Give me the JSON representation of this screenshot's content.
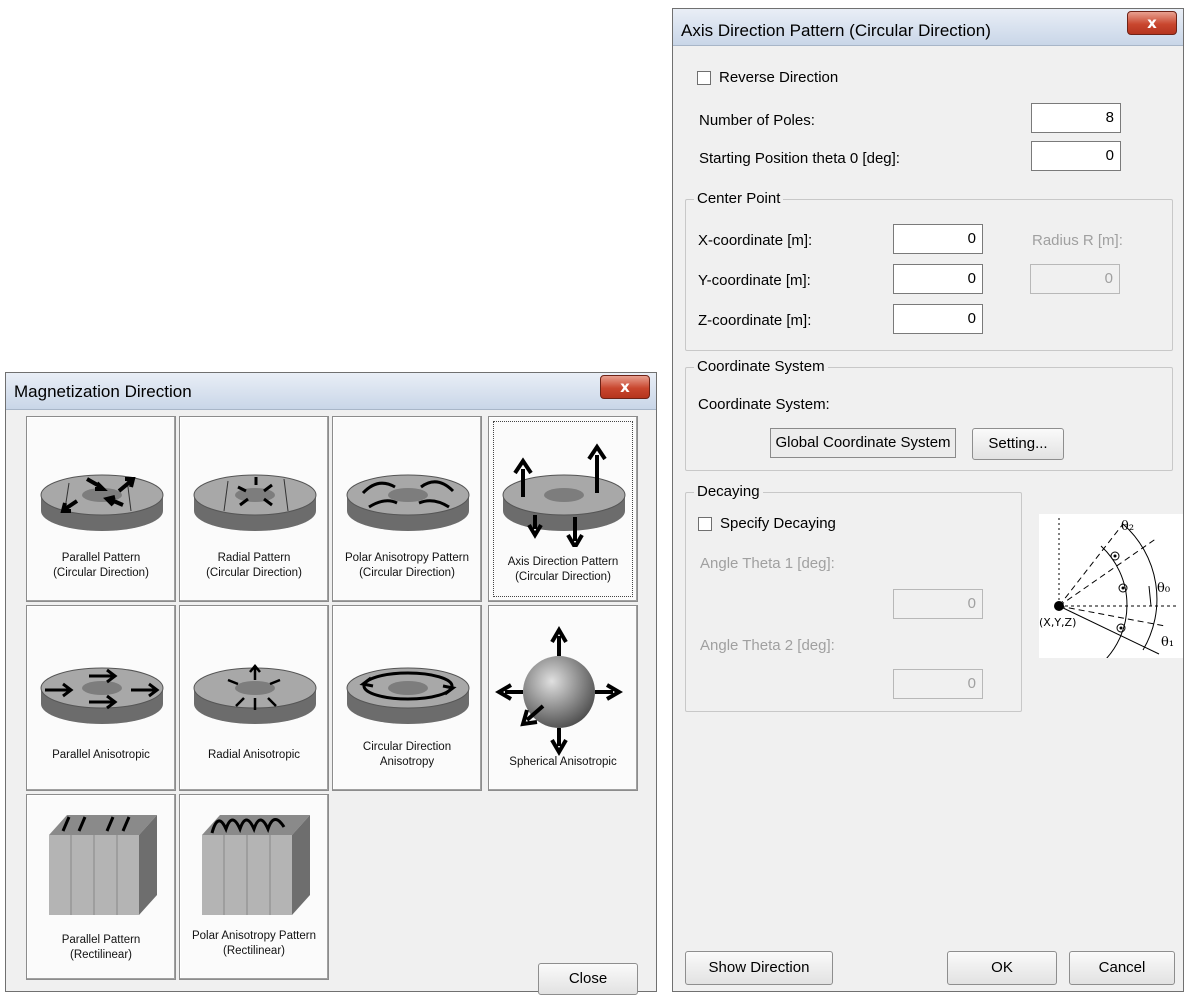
{
  "magnetization": {
    "title": "Magnetization Direction",
    "close_label": "Close",
    "patterns": [
      {
        "line1": "Parallel Pattern",
        "line2": "(Circular Direction)"
      },
      {
        "line1": "Radial Pattern",
        "line2": "(Circular Direction)"
      },
      {
        "line1": "Polar Anisotropy Pattern",
        "line2": "(Circular Direction)"
      },
      {
        "line1": "Axis Direction Pattern",
        "line2": "(Circular Direction)"
      },
      {
        "line1": "Parallel Anisotropic",
        "line2": ""
      },
      {
        "line1": "Radial Anisotropic",
        "line2": ""
      },
      {
        "line1": "Circular Direction",
        "line2": "Anisotropy"
      },
      {
        "line1": "Spherical Anisotropic",
        "line2": ""
      },
      {
        "line1": "Parallel Pattern",
        "line2": "(Rectilinear)"
      },
      {
        "line1": "Polar Anisotropy Pattern",
        "line2": "(Rectilinear)"
      }
    ]
  },
  "axis_dialog": {
    "title": "Axis Direction Pattern (Circular Direction)",
    "reverse_direction_label": "Reverse Direction",
    "reverse_direction_checked": false,
    "poles_label": "Number of Poles:",
    "poles_value": "8",
    "start_label": "Starting Position theta 0 [deg]:",
    "start_value": "0",
    "center_point": {
      "title": "Center Point",
      "x_label": "X-coordinate [m]:",
      "x_value": "0",
      "y_label": "Y-coordinate [m]:",
      "y_value": "0",
      "z_label": "Z-coordinate [m]:",
      "z_value": "0",
      "radius_label": "Radius R [m]:",
      "radius_value": "0"
    },
    "coordinate_system": {
      "title": "Coordinate System",
      "label": "Coordinate System:",
      "value": "Global Coordinate System",
      "setting_label": "Setting..."
    },
    "decaying": {
      "title": "Decaying",
      "specify_label": "Specify Decaying",
      "specify_checked": false,
      "theta1_label": "Angle Theta 1 [deg]:",
      "theta1_value": "0",
      "theta2_label": "Angle Theta 2 [deg]:",
      "theta2_value": "0"
    },
    "diagram": {
      "theta2": "θ₂",
      "theta0": "θ₀",
      "theta1": "θ₁",
      "origin": "(X,Y,Z)"
    },
    "show_direction_label": "Show Direction",
    "ok_label": "OK",
    "cancel_label": "Cancel",
    "close_glyph": "x"
  }
}
